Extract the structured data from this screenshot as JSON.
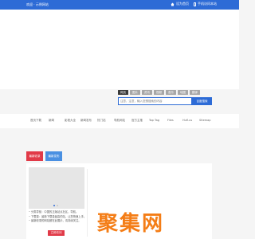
{
  "topbar": {
    "welcome_text": "欢迎 · 示例网站",
    "items": [
      {
        "icon": "home-icon",
        "label": "设为首页"
      },
      {
        "icon": "mobile-icon",
        "label": "手机访问本站"
      }
    ]
  },
  "search": {
    "tabs": [
      "网页",
      "图片",
      "资讯",
      "视频",
      "音乐",
      "地图",
      "翻译"
    ],
    "active_tab": 0,
    "placeholder": "注意，注意，输入您想搜索的内容",
    "button_label": "百度搜索"
  },
  "nav": {
    "items": [
      "首页下载",
      "新闻",
      "影视大全",
      "新闻发布",
      "热门站",
      "导航网站",
      "官方主推",
      "Top Tag",
      "Files",
      "Hufl.us",
      "Sitemap"
    ]
  },
  "filters": {
    "items": [
      {
        "label": "最新收录",
        "color": "#e13a48"
      },
      {
        "label": "最新发布",
        "color": "#4a90e2"
      }
    ]
  },
  "content": {
    "lines": [
      "分类导航：中国的正版站点社区，导航。",
      "下载量：最新下载量最高的站，让您快速上手。",
      "最新收录的网站都在此展示，请持续关注。"
    ],
    "button_label": "立即访问"
  },
  "watermark": {
    "text": "聚集网"
  },
  "colors": {
    "primary": "#2d6bd6",
    "accent_red": "#e13a48",
    "accent_blue": "#4a90e2",
    "watermark_orange": "#f47d16"
  }
}
